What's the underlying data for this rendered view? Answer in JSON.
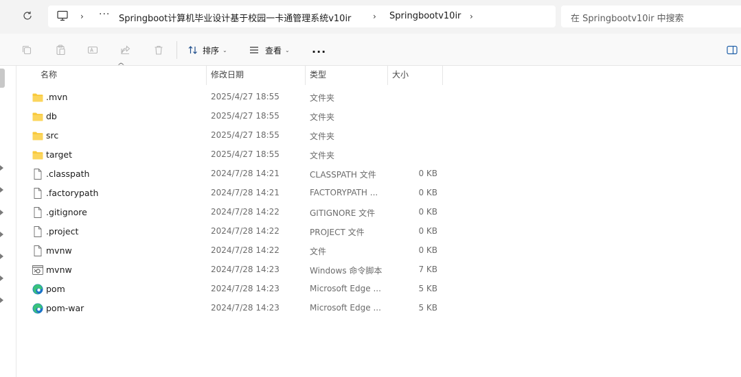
{
  "address_bar": {
    "crumbs": [
      "Springboot计算机毕业设计基于校园一卡通管理系统v10ir",
      "Springbootv10ir"
    ],
    "more": "···",
    "search_placeholder": "在 Springbootv10ir 中搜索"
  },
  "command_bar": {
    "sort_label": "排序",
    "view_label": "查看",
    "more_label": "···"
  },
  "columns": {
    "name": "名称",
    "date": "修改日期",
    "type": "类型",
    "size": "大小"
  },
  "files": [
    {
      "name": ".mvn",
      "date": "2025/4/27 18:55",
      "type": "文件夹",
      "size": "",
      "icon": "folder-icon"
    },
    {
      "name": "db",
      "date": "2025/4/27 18:55",
      "type": "文件夹",
      "size": "",
      "icon": "folder-icon"
    },
    {
      "name": "src",
      "date": "2025/4/27 18:55",
      "type": "文件夹",
      "size": "",
      "icon": "folder-icon"
    },
    {
      "name": "target",
      "date": "2025/4/27 18:55",
      "type": "文件夹",
      "size": "",
      "icon": "folder-icon"
    },
    {
      "name": ".classpath",
      "date": "2024/7/28 14:21",
      "type": "CLASSPATH 文件",
      "size": "0 KB",
      "icon": "file-icon"
    },
    {
      "name": ".factorypath",
      "date": "2024/7/28 14:21",
      "type": "FACTORYPATH ...",
      "size": "0 KB",
      "icon": "file-icon"
    },
    {
      "name": ".gitignore",
      "date": "2024/7/28 14:22",
      "type": "GITIGNORE 文件",
      "size": "0 KB",
      "icon": "file-icon"
    },
    {
      "name": ".project",
      "date": "2024/7/28 14:22",
      "type": "PROJECT 文件",
      "size": "0 KB",
      "icon": "file-icon"
    },
    {
      "name": "mvnw",
      "date": "2024/7/28 14:22",
      "type": "文件",
      "size": "0 KB",
      "icon": "file-icon"
    },
    {
      "name": "mvnw",
      "date": "2024/7/28 14:23",
      "type": "Windows 命令脚本",
      "size": "7 KB",
      "icon": "script-icon"
    },
    {
      "name": "pom",
      "date": "2024/7/28 14:23",
      "type": "Microsoft Edge ...",
      "size": "5 KB",
      "icon": "edge-icon"
    },
    {
      "name": "pom-war",
      "date": "2024/7/28 14:23",
      "type": "Microsoft Edge ...",
      "size": "5 KB",
      "icon": "edge-icon"
    }
  ],
  "colors": {
    "folder": "#f8c93c",
    "edge_blue": "#1a73c8",
    "edge_green": "#3ac27a"
  }
}
